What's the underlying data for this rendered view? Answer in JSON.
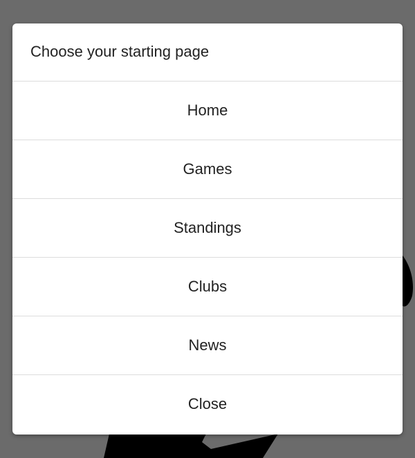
{
  "dialog": {
    "title": "Choose your starting page",
    "options": [
      {
        "label": "Home"
      },
      {
        "label": "Games"
      },
      {
        "label": "Standings"
      },
      {
        "label": "Clubs"
      },
      {
        "label": "News"
      }
    ],
    "close_label": "Close"
  }
}
